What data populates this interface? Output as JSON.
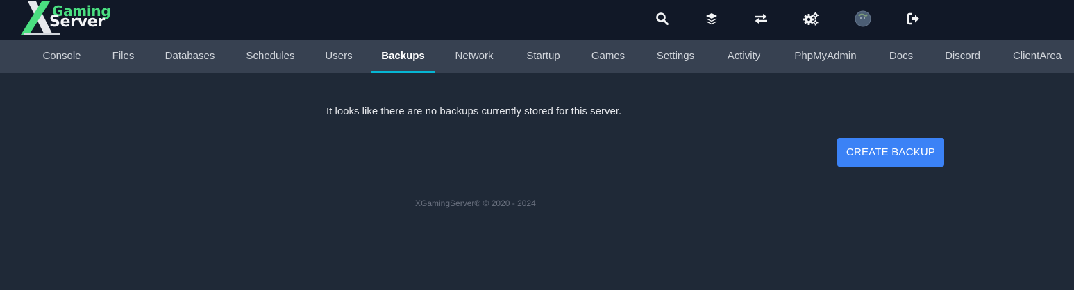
{
  "brand": {
    "logo_line1": "Gaming",
    "logo_line2": "Server"
  },
  "header_icons": [
    {
      "name": "search-icon"
    },
    {
      "name": "layers-icon"
    },
    {
      "name": "swap-icon"
    },
    {
      "name": "gears-icon"
    },
    {
      "name": "avatar"
    },
    {
      "name": "logout-icon"
    }
  ],
  "nav": {
    "items": [
      {
        "label": "Console"
      },
      {
        "label": "Files"
      },
      {
        "label": "Databases"
      },
      {
        "label": "Schedules"
      },
      {
        "label": "Users"
      },
      {
        "label": "Backups",
        "active": true
      },
      {
        "label": "Network"
      },
      {
        "label": "Startup"
      },
      {
        "label": "Games"
      },
      {
        "label": "Settings"
      },
      {
        "label": "Activity"
      },
      {
        "label": "PhpMyAdmin"
      },
      {
        "label": "Docs"
      },
      {
        "label": "Discord"
      },
      {
        "label": "ClientArea"
      }
    ]
  },
  "main": {
    "empty_message": "It looks like there are no backups currently stored for this server.",
    "create_button_label": "CREATE BACKUP"
  },
  "footer": {
    "text": "XGamingServer® © 2020 - 2024"
  },
  "colors": {
    "accent": "#3b82f6",
    "brand_green": "#4ade80",
    "active_underline": "#06b6d4"
  }
}
